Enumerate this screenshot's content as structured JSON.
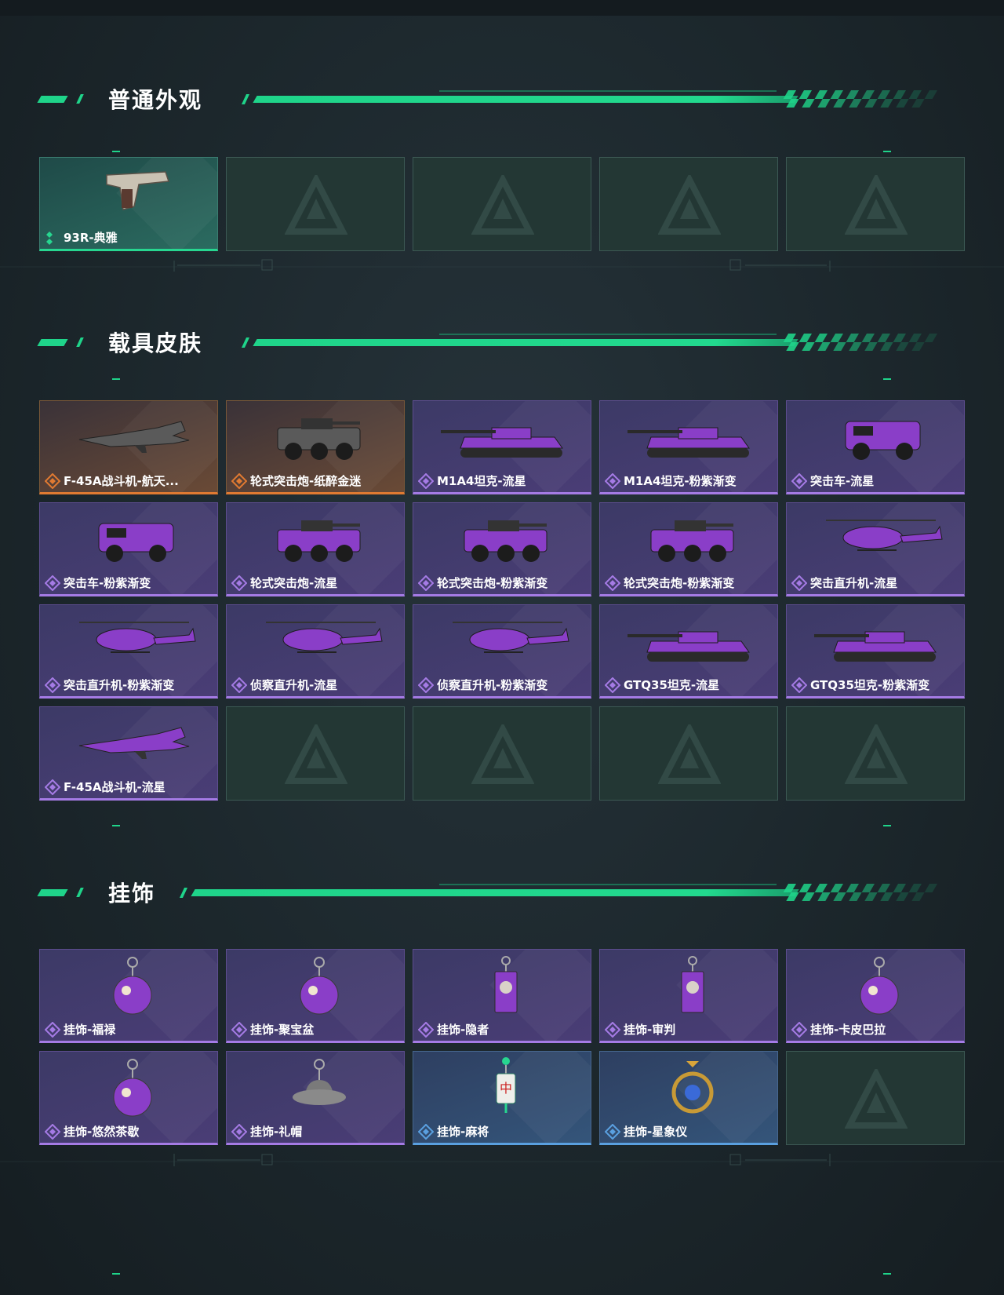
{
  "sections": [
    {
      "title": "普通外观",
      "items": [
        {
          "label": "93R-典雅",
          "rarity": "teal",
          "art": "pistol-icon"
        },
        {
          "label": "",
          "rarity": "empty"
        },
        {
          "label": "",
          "rarity": "empty"
        },
        {
          "label": "",
          "rarity": "empty"
        },
        {
          "label": "",
          "rarity": "empty"
        }
      ]
    },
    {
      "title": "载具皮肤",
      "items": [
        {
          "label": "F-45A战斗机-航天...",
          "rarity": "orange",
          "art": "jet-icon"
        },
        {
          "label": "轮式突击炮-纸醉金迷",
          "rarity": "orange",
          "art": "wheeled-vehicle-icon"
        },
        {
          "label": "M1A4坦克-流星",
          "rarity": "purple",
          "art": "tank-icon"
        },
        {
          "label": "M1A4坦克-粉紫渐变",
          "rarity": "purple",
          "art": "tank-icon"
        },
        {
          "label": "突击车-流星",
          "rarity": "purple",
          "art": "armored-car-icon"
        },
        {
          "label": "突击车-粉紫渐变",
          "rarity": "purple",
          "art": "armored-car-icon"
        },
        {
          "label": "轮式突击炮-流星",
          "rarity": "purple",
          "art": "wheeled-vehicle-icon"
        },
        {
          "label": "轮式突击炮-粉紫渐变",
          "rarity": "purple",
          "art": "wheeled-vehicle-icon"
        },
        {
          "label": "轮式突击炮-粉紫渐变",
          "rarity": "purple",
          "art": "wheeled-vehicle-icon"
        },
        {
          "label": "突击直升机-流星",
          "rarity": "purple",
          "art": "helicopter-icon"
        },
        {
          "label": "突击直升机-粉紫渐变",
          "rarity": "purple",
          "art": "helicopter-icon"
        },
        {
          "label": "侦察直升机-流星",
          "rarity": "purple",
          "art": "helicopter-icon"
        },
        {
          "label": "侦察直升机-粉紫渐变",
          "rarity": "purple",
          "art": "helicopter-icon"
        },
        {
          "label": "GTQ35坦克-流星",
          "rarity": "purple",
          "art": "tank-icon"
        },
        {
          "label": "GTQ35坦克-粉紫渐变",
          "rarity": "purple",
          "art": "tank-icon"
        },
        {
          "label": "F-45A战斗机-流星",
          "rarity": "purple",
          "art": "jet-icon"
        },
        {
          "label": "",
          "rarity": "empty"
        },
        {
          "label": "",
          "rarity": "empty"
        },
        {
          "label": "",
          "rarity": "empty"
        },
        {
          "label": "",
          "rarity": "empty"
        }
      ]
    },
    {
      "title": "挂饰",
      "items": [
        {
          "label": "挂饰-福禄",
          "rarity": "purple",
          "art": "charm-icon"
        },
        {
          "label": "挂饰-聚宝盆",
          "rarity": "purple",
          "art": "charm-icon"
        },
        {
          "label": "挂饰-隐者",
          "rarity": "purple",
          "art": "card-charm-icon"
        },
        {
          "label": "挂饰-审判",
          "rarity": "purple",
          "art": "card-charm-icon"
        },
        {
          "label": "挂饰-卡皮巴拉",
          "rarity": "purple",
          "art": "charm-icon"
        },
        {
          "label": "挂饰-悠然茶歇",
          "rarity": "purple",
          "art": "charm-icon"
        },
        {
          "label": "挂饰-礼帽",
          "rarity": "purple",
          "art": "hat-charm-icon"
        },
        {
          "label": "挂饰-麻将",
          "rarity": "blue",
          "art": "mahjong-charm-icon"
        },
        {
          "label": "挂饰-星象仪",
          "rarity": "blue",
          "art": "astrolabe-charm-icon"
        },
        {
          "label": "",
          "rarity": "empty"
        }
      ]
    }
  ],
  "colors": {
    "accent": "#1fd48a",
    "purple": "#a57be5",
    "orange": "#e07a32",
    "teal": "#27d690",
    "blue": "#5aa0e0"
  }
}
